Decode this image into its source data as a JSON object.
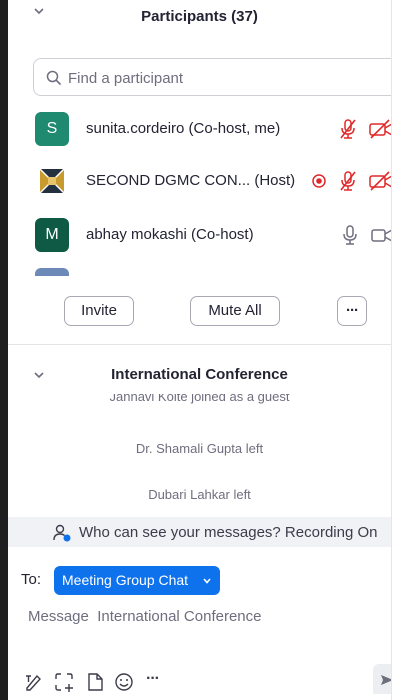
{
  "participants_panel": {
    "title": "Participants (37)",
    "search_placeholder": "Find a participant",
    "participants": [
      {
        "avatar_letter": "S",
        "avatar_color": "#1f8a70",
        "name": "sunita.cordeiro (Co-host, me)",
        "mic": "muted",
        "video": "off"
      },
      {
        "avatar_letter": "",
        "avatar_color": "#ffffff",
        "name": "SECOND DGMC CON... (Host)",
        "recording": true,
        "mic": "muted",
        "video": "off"
      },
      {
        "avatar_letter": "M",
        "avatar_color": "#0f5a45",
        "name": "abhay mokashi (Co-host)",
        "mic": "on",
        "video": "on"
      }
    ],
    "invite_label": "Invite",
    "mute_all_label": "Mute All",
    "more_label": "···"
  },
  "chat_panel": {
    "title": "International Conference",
    "messages": [
      "Jahnavi Kolte joined as a guest",
      "Dr. Shamali Gupta left",
      "Dubari Lahkar left"
    ],
    "who_can_see": "Who can see your messages? Recording On",
    "to_label": "To:",
    "recipient": "Meeting Group Chat",
    "message_placeholder": "Message  International Conference",
    "toolbar_more": "···"
  },
  "colors": {
    "accent": "#0e72ed",
    "muted_red": "#e02828",
    "text": "#232333",
    "secondary_text": "#6e6e7e"
  },
  "icons": [
    "chevron-down-icon",
    "search-icon",
    "mic-muted-icon",
    "video-off-icon",
    "recording-icon",
    "mic-icon",
    "video-icon",
    "who-can-see-icon",
    "format-icon",
    "screenshot-icon",
    "file-icon",
    "emoji-icon",
    "more-icon",
    "send-icon"
  ]
}
